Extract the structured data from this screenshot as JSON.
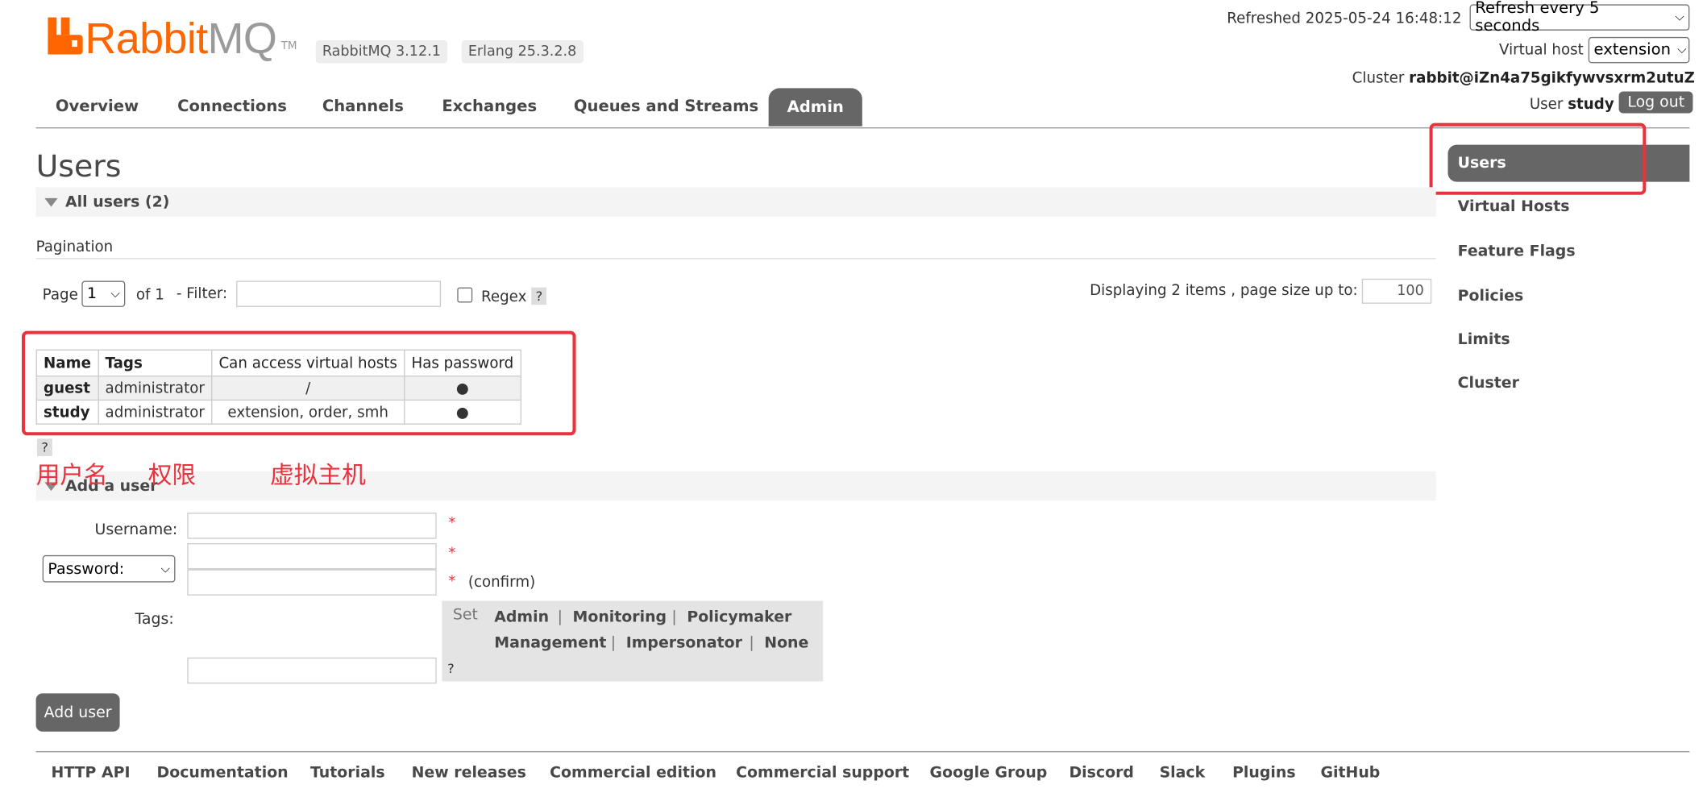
{
  "header": {
    "logo": {
      "rabbit": "Rabbit",
      "mq": "MQ",
      "tm": "TM"
    },
    "version_badge": "RabbitMQ 3.12.1",
    "erlang_badge": "Erlang 25.3.2.8",
    "refreshed_label": "Refreshed 2025-05-24 16:48:12",
    "refresh_select": "Refresh every 5 seconds",
    "vhost_label": "Virtual host",
    "vhost_select": "extension",
    "cluster_label": "Cluster",
    "cluster_name": "rabbit@iZn4a75gikfywvsxrm2utuZ",
    "user_label": "User",
    "user_name": "study",
    "logout": "Log out"
  },
  "nav": {
    "tabs": [
      "Overview",
      "Connections",
      "Channels",
      "Exchanges",
      "Queues and Streams",
      "Admin"
    ],
    "active": "Admin"
  },
  "side_menu": [
    "Users",
    "Virtual Hosts",
    "Feature Flags",
    "Policies",
    "Limits",
    "Cluster"
  ],
  "page_title": "Users",
  "all_users": {
    "section_title": "All users (2)",
    "pagination_label": "Pagination",
    "page_label": "Page",
    "page_value": "1",
    "of_label": "of 1",
    "filter_label": "- Filter:",
    "filter_value": "",
    "regex_label": "Regex",
    "help": "?",
    "displaying": "Displaying 2 items , page size up to:",
    "page_size": "100",
    "columns": [
      "Name",
      "Tags",
      "Can access virtual hosts",
      "Has password"
    ],
    "rows": [
      {
        "name": "guest",
        "tags": "administrator",
        "vhosts": "/",
        "has_password": "●"
      },
      {
        "name": "study",
        "tags": "administrator",
        "vhosts": "extension, order, smh",
        "has_password": "●"
      }
    ]
  },
  "annotations": {
    "username": "用户名",
    "permission": "权限",
    "vhost": "虚拟主机"
  },
  "add_user": {
    "section_title": "Add a user",
    "username_label": "Username:",
    "password_select": "Password:",
    "confirm_label": "(confirm)",
    "required_mark": "*",
    "tags_label": "Tags:",
    "set_label": "Set",
    "tag_options": [
      "Admin",
      "Monitoring",
      "Policymaker",
      "Management",
      "Impersonator",
      "None"
    ],
    "separator": "|",
    "help": "?",
    "submit": "Add user"
  },
  "footer": [
    "HTTP API",
    "Documentation",
    "Tutorials",
    "New releases",
    "Commercial edition",
    "Commercial support",
    "Google Group",
    "Discord",
    "Slack",
    "Plugins",
    "GitHub"
  ],
  "colors": {
    "brand": "#ff6600",
    "annotation_red": "#e8333f",
    "nav_active": "#666666"
  }
}
